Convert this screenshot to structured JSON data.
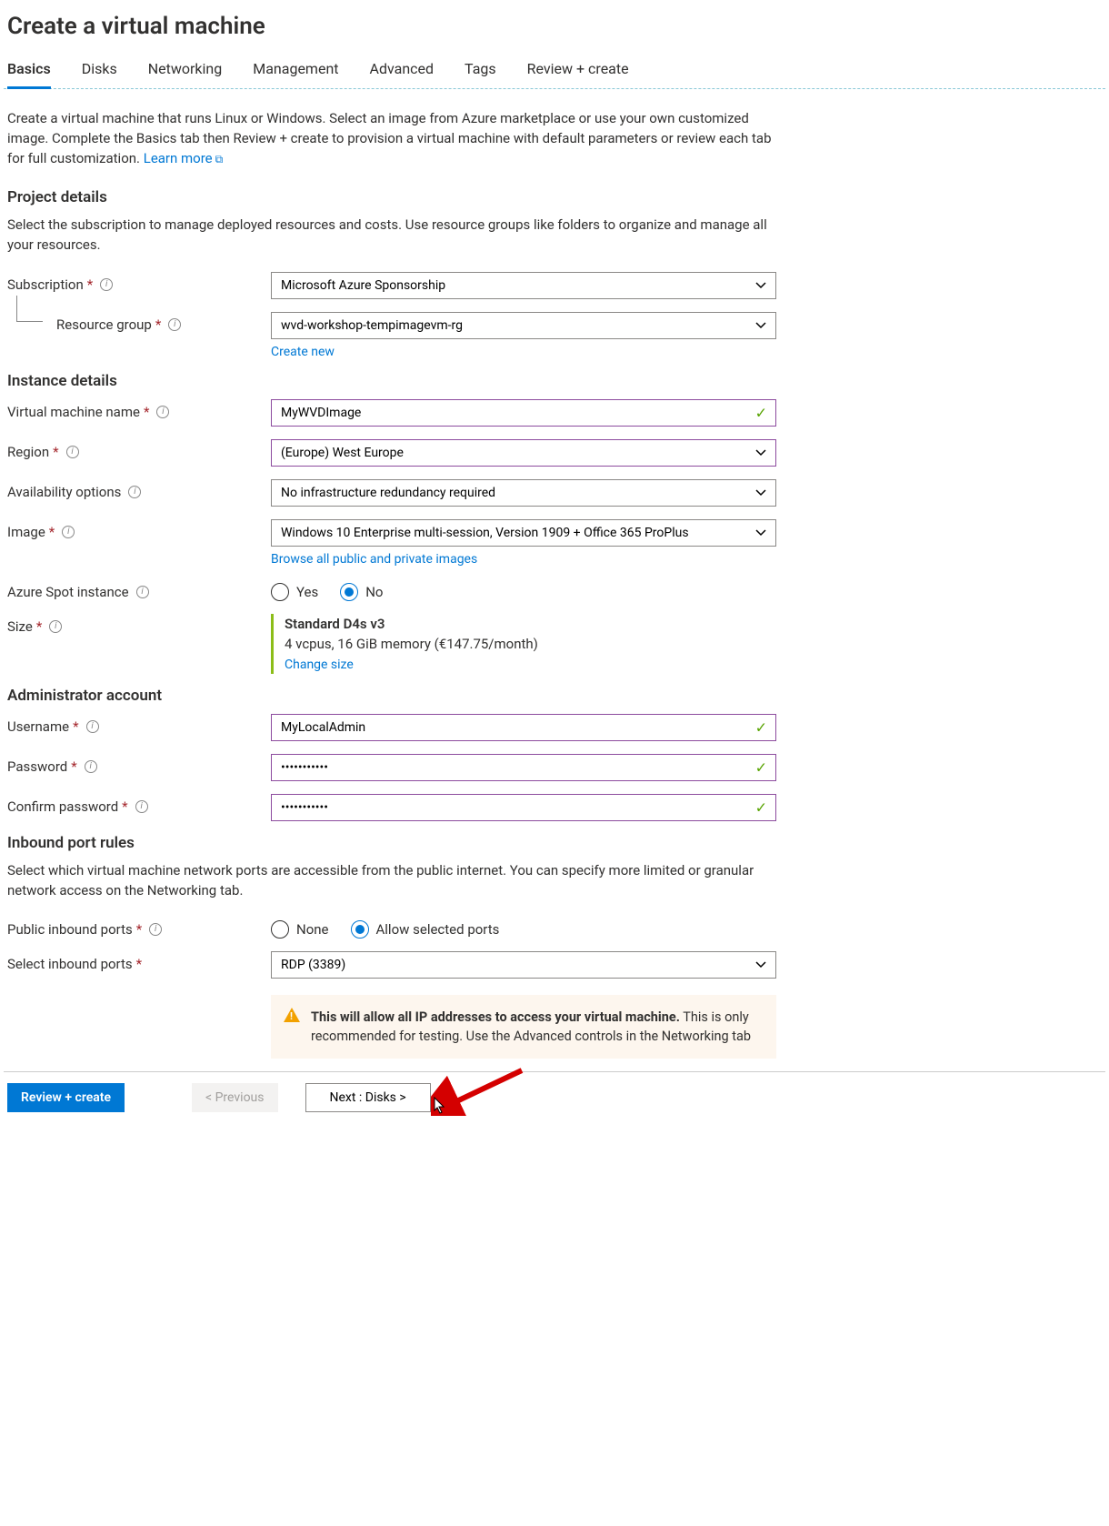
{
  "title": "Create a virtual machine",
  "tabs": {
    "basics": "Basics",
    "disks": "Disks",
    "networking": "Networking",
    "management": "Management",
    "advanced": "Advanced",
    "tags": "Tags",
    "review": "Review + create"
  },
  "intro": {
    "text": "Create a virtual machine that runs Linux or Windows. Select an image from Azure marketplace or use your own customized image. Complete the Basics tab then Review + create to provision a virtual machine with default parameters or review each tab for full customization. ",
    "learn_more": "Learn more"
  },
  "project_details": {
    "heading": "Project details",
    "desc": "Select the subscription to manage deployed resources and costs. Use resource groups like folders to organize and manage all your resources.",
    "subscription_label": "Subscription",
    "subscription_value": "Microsoft Azure Sponsorship",
    "rg_label": "Resource group",
    "rg_value": "wvd-workshop-tempimagevm-rg",
    "create_new": "Create new"
  },
  "instance_details": {
    "heading": "Instance details",
    "vm_name_label": "Virtual machine name",
    "vm_name_value": "MyWVDImage",
    "region_label": "Region",
    "region_value": "(Europe) West Europe",
    "avail_label": "Availability options",
    "avail_value": "No infrastructure redundancy required",
    "image_label": "Image",
    "image_value": "Windows 10 Enterprise multi-session, Version 1909 + Office 365 ProPlus",
    "browse_images": "Browse all public and private images",
    "spot_label": "Azure Spot instance",
    "spot_yes": "Yes",
    "spot_no": "No",
    "size_label": "Size",
    "size_name": "Standard D4s v3",
    "size_detail": "4 vcpus, 16 GiB memory (€147.75/month)",
    "change_size": "Change size"
  },
  "admin": {
    "heading": "Administrator account",
    "username_label": "Username",
    "username_value": "MyLocalAdmin",
    "password_label": "Password",
    "password_value": "•••••••••••",
    "confirm_label": "Confirm password",
    "confirm_value": "•••••••••••"
  },
  "inbound": {
    "heading": "Inbound port rules",
    "desc": "Select which virtual machine network ports are accessible from the public internet. You can specify more limited or granular network access on the Networking tab.",
    "public_label": "Public inbound ports",
    "none": "None",
    "allow": "Allow selected ports",
    "select_label": "Select inbound ports",
    "select_value": "RDP (3389)",
    "warn_bold": "This will allow all IP addresses to access your virtual machine.",
    "warn_rest": "  This is only recommended for testing.  Use the Advanced controls in the Networking tab"
  },
  "footer": {
    "review": "Review + create",
    "previous": "< Previous",
    "next": "Next : Disks >"
  }
}
